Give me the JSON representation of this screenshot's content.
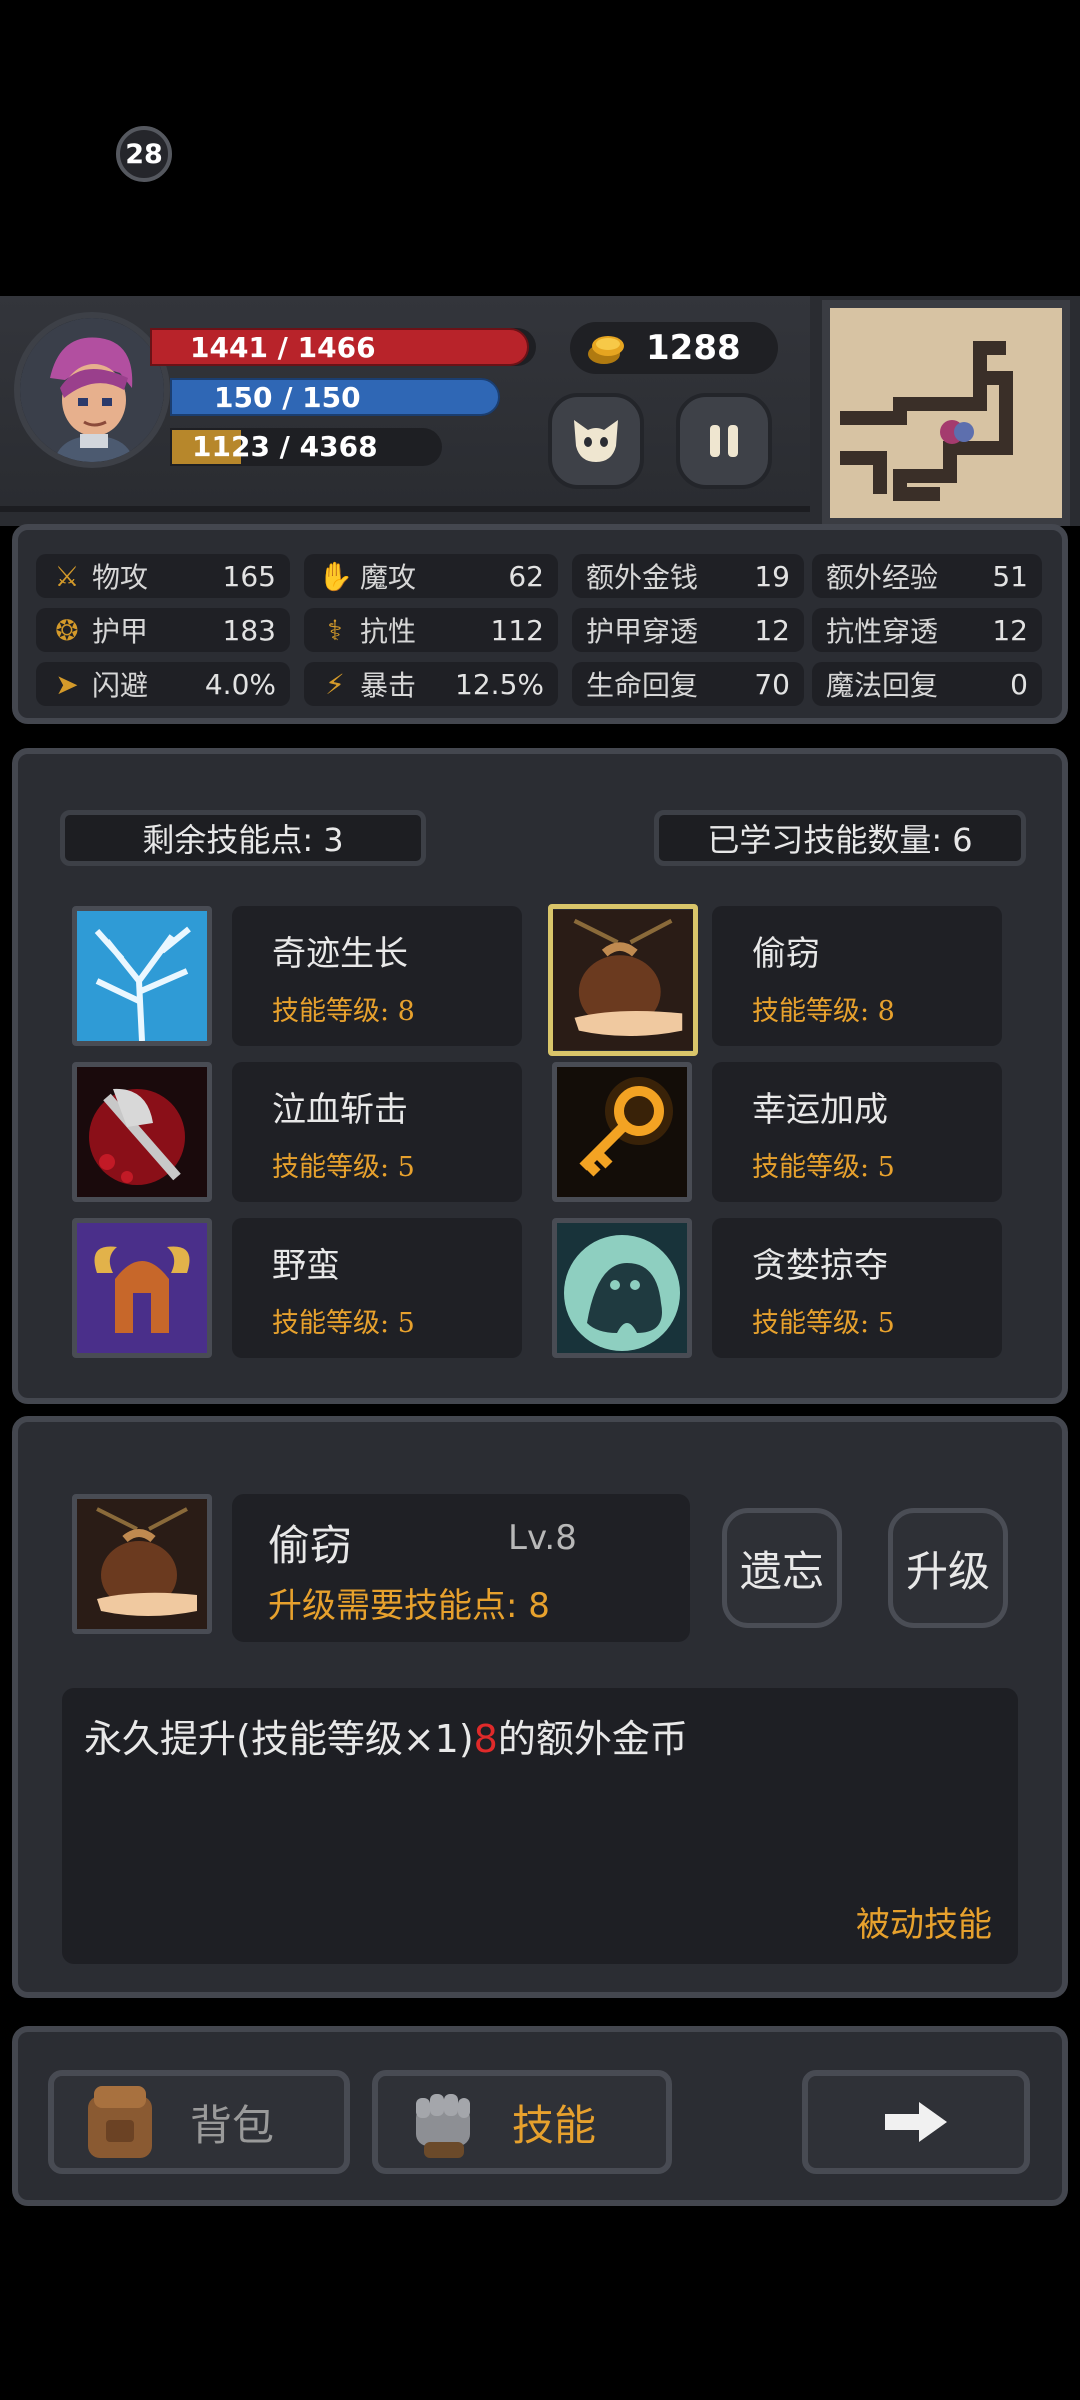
{
  "player": {
    "level": "28",
    "hp": "1441 / 1466",
    "hp_fraction": 0.983,
    "mp": "150 / 150",
    "mp_fraction": 1.0,
    "xp": "1123 / 4368",
    "xp_fraction": 0.257,
    "gold": "1288"
  },
  "stats": [
    {
      "icon": "sword-icon",
      "name": "物攻",
      "value": "165"
    },
    {
      "icon": "magic-hand-icon",
      "name": "魔攻",
      "value": "62"
    },
    {
      "icon": "",
      "name": "额外金钱",
      "value": "19"
    },
    {
      "icon": "",
      "name": "额外经验",
      "value": "51"
    },
    {
      "icon": "paw-armor-icon",
      "name": "护甲",
      "value": "183"
    },
    {
      "icon": "resist-icon",
      "name": "抗性",
      "value": "112"
    },
    {
      "icon": "",
      "name": "护甲穿透",
      "value": "12"
    },
    {
      "icon": "",
      "name": "抗性穿透",
      "value": "12"
    },
    {
      "icon": "running-icon",
      "name": "闪避",
      "value": "4.0%"
    },
    {
      "icon": "lightning-icon",
      "name": "暴击",
      "value": "12.5%"
    },
    {
      "icon": "",
      "name": "生命回复",
      "value": "70"
    },
    {
      "icon": "",
      "name": "魔法回复",
      "value": "0"
    }
  ],
  "skills_header": {
    "remaining": "剩余技能点: 3",
    "learned": "已学习技能数量: 6"
  },
  "skills": [
    {
      "name": "奇迹生长",
      "level": "技能等级: 8",
      "icon": "lightning-tree-icon"
    },
    {
      "name": "偷窃",
      "level": "技能等级: 8",
      "icon": "money-bag-hand-icon"
    },
    {
      "name": "泣血斩击",
      "level": "技能等级: 5",
      "icon": "bloody-axe-icon"
    },
    {
      "name": "幸运加成",
      "level": "技能等级: 5",
      "icon": "golden-key-icon"
    },
    {
      "name": "野蛮",
      "level": "技能等级: 5",
      "icon": "horned-helmet-icon"
    },
    {
      "name": "贪婪掠夺",
      "level": "技能等级: 5",
      "icon": "ghost-beast-icon"
    }
  ],
  "detail": {
    "name": "偷窃",
    "level": "Lv.8",
    "cost": "升级需要技能点: 8",
    "forget_label": "遗忘",
    "upgrade_label": "升级",
    "desc_before": "永久提升(技能等级×1)",
    "desc_value": "8",
    "desc_after": "的额外金币",
    "type": "被动技能"
  },
  "nav": {
    "bag": "背包",
    "skills": "技能"
  },
  "colors": {
    "accent_orange": "#e7a12d",
    "hp_red": "#b8232a",
    "mp_blue": "#2f67b5",
    "highlight_red": "#e02a2a"
  }
}
